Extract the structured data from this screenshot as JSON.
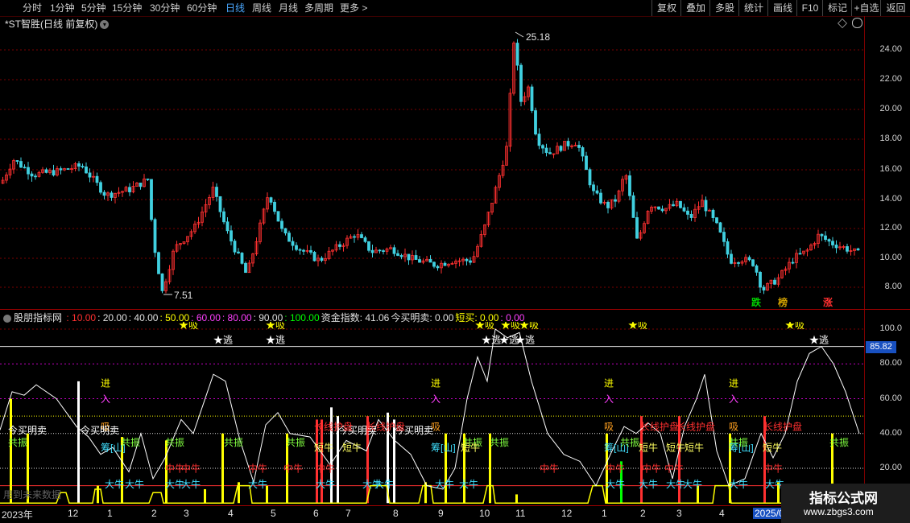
{
  "toolbar": {
    "periods": [
      "分时",
      "1分钟",
      "5分钟",
      "15分钟",
      "30分钟",
      "60分钟",
      "日线",
      "周线",
      "月线",
      "多周期",
      "更多 >"
    ],
    "active": "日线",
    "right_buttons": [
      "复权",
      "叠加",
      "多股",
      "统计",
      "画线",
      "F10",
      "标记",
      "+自选",
      "返回"
    ]
  },
  "chart": {
    "stock_title": "*ST智胜(日线 前复权)",
    "high_label": "25.18",
    "low_label": "7.51",
    "y_ticks": [
      "24.00",
      "22.00",
      "20.00",
      "18.00",
      "16.00",
      "14.00",
      "12.00",
      "10.00",
      "8.00"
    ],
    "markers": [
      {
        "text": "跌",
        "color": "#00d000"
      },
      {
        "text": "榜",
        "color": "#d0a000"
      },
      {
        "text": "涨",
        "color": "#ff3030"
      }
    ]
  },
  "indicator": {
    "name": "股朋指标网",
    "params": [
      {
        "text": ": 10.00",
        "color": "#ff3030"
      },
      {
        "text": ": 20.00",
        "color": "#e0e0e0"
      },
      {
        "text": ": 40.00",
        "color": "#e0e0e0"
      },
      {
        "text": ": 50.00",
        "color": "#ffff00"
      },
      {
        "text": ": 60.00",
        "color": "#ff40ff"
      },
      {
        "text": ": 80.00",
        "color": "#ff40ff"
      },
      {
        "text": ": 90.00",
        "color": "#e0e0e0"
      },
      {
        "text": ": 100.00",
        "color": "#00ff00"
      },
      {
        "text": "资金指数: 41.06",
        "color": "#e0e0e0"
      },
      {
        "text": "今买明卖: 0.00",
        "color": "#e0e0e0"
      },
      {
        "text": "短买: 0.00",
        "color": "#ffff00"
      },
      {
        "text": ": 0.00",
        "color": "#ff40ff"
      }
    ],
    "y_ticks": [
      "100.0",
      "80.00",
      "60.00",
      "40.00",
      "20.00"
    ],
    "current_value": "85.82",
    "labels": {
      "escape": "★逃",
      "absorb_star": "★吸",
      "enter": "进",
      "entry": "入",
      "absorb": "吸",
      "chip": "筹",
      "chip_full": "筹码",
      "resonance": "共振",
      "short_bull": "短牛",
      "mid_bull": "中牛",
      "big_bull": "大牛",
      "buy_today_sell_tomorrow": "今买明卖",
      "long_line_start": "长线护盘",
      "wash": "洗",
      "future": "用到未来数据"
    }
  },
  "x_axis": {
    "labels": [
      "2023年",
      "12",
      "1",
      "2",
      "3",
      "4",
      "5",
      "6",
      "7",
      "8",
      "9",
      "10",
      "11",
      "12",
      "1",
      "2",
      "3",
      "4",
      "2025/0"
    ]
  },
  "watermark": {
    "title": "指标公式网",
    "url": "www.zbgs3.com"
  },
  "colors": {
    "up": "#ff3030",
    "down": "#40d0e0",
    "grid": "#7a0000",
    "accent": "#4aa8ff"
  }
}
